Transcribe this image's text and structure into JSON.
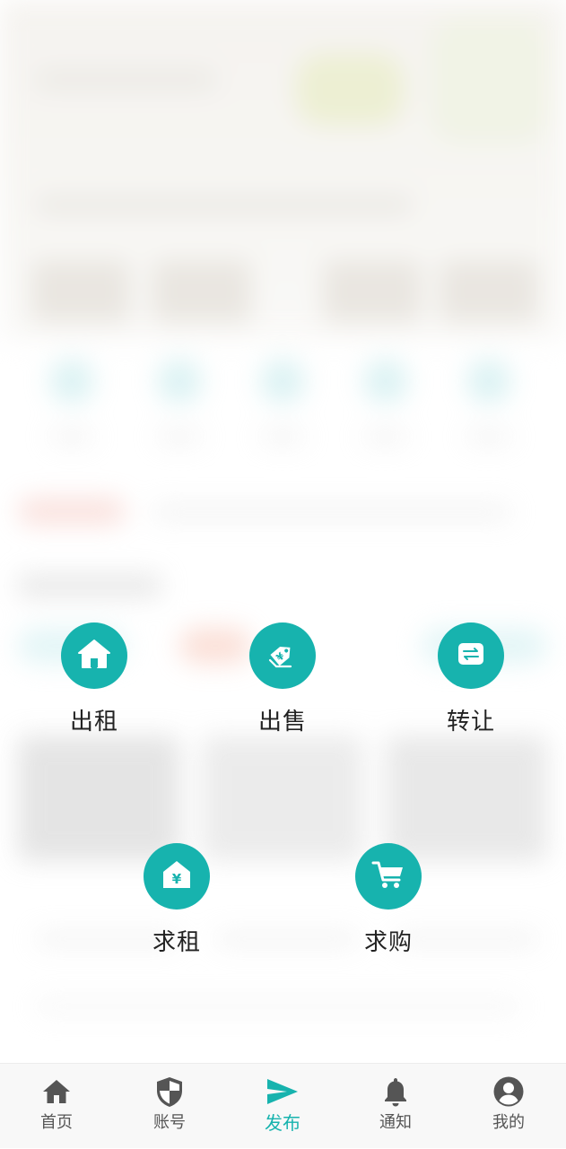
{
  "theme": {
    "accent": "#17b3ae",
    "tab_inactive": "#555555",
    "label_color": "#222222"
  },
  "publish_menu": {
    "items": [
      {
        "label": "出租",
        "icon": "house-icon"
      },
      {
        "label": "出售",
        "icon": "price-tag-yen-icon"
      },
      {
        "label": "转让",
        "icon": "swap-arrows-icon"
      },
      {
        "label": "求租",
        "icon": "house-yen-icon"
      },
      {
        "label": "求购",
        "icon": "shopping-cart-icon"
      }
    ]
  },
  "tabbar": {
    "items": [
      {
        "label": "首页",
        "icon": "home-icon"
      },
      {
        "label": "账号",
        "icon": "shield-icon"
      },
      {
        "label": "发布",
        "icon": "send-icon",
        "active": true
      },
      {
        "label": "通知",
        "icon": "bell-icon"
      },
      {
        "label": "我的",
        "icon": "user-circle-icon"
      }
    ]
  }
}
